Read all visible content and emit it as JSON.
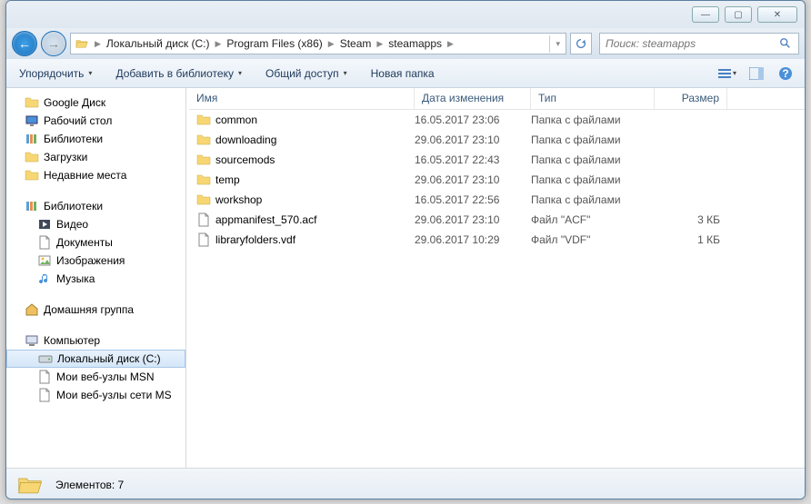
{
  "window_controls": {
    "min": "—",
    "max": "▢",
    "close": "✕"
  },
  "breadcrumbs": [
    "Локальный диск (C:)",
    "Program Files (x86)",
    "Steam",
    "steamapps"
  ],
  "search": {
    "placeholder": "Поиск: steamapps"
  },
  "toolbar": {
    "organize": "Упорядочить",
    "add_library": "Добавить в библиотеку",
    "share": "Общий доступ",
    "new_folder": "Новая папка"
  },
  "columns": {
    "name": "Имя",
    "date": "Дата изменения",
    "type": "Тип",
    "size": "Размер"
  },
  "nav": {
    "favorites": [
      {
        "label": "Google Диск",
        "icon": "gdrive"
      },
      {
        "label": "Рабочий стол",
        "icon": "desktop"
      },
      {
        "label": "Библиотеки",
        "icon": "library"
      },
      {
        "label": "Загрузки",
        "icon": "downloads"
      },
      {
        "label": "Недавние места",
        "icon": "recent"
      }
    ],
    "libraries_header": "Библиотеки",
    "libraries": [
      {
        "label": "Видео",
        "icon": "video"
      },
      {
        "label": "Документы",
        "icon": "doc"
      },
      {
        "label": "Изображения",
        "icon": "image"
      },
      {
        "label": "Музыка",
        "icon": "music"
      }
    ],
    "homegroup": "Домашняя группа",
    "computer": "Компьютер",
    "computer_items": [
      {
        "label": "Локальный диск (C:)",
        "icon": "drive",
        "sel": true
      },
      {
        "label": "Мои веб-узлы MSN",
        "icon": "page"
      },
      {
        "label": "Мои веб-узлы сети MS",
        "icon": "page"
      }
    ]
  },
  "files": [
    {
      "name": "common",
      "date": "16.05.2017 23:06",
      "type": "Папка с файлами",
      "size": "",
      "kind": "folder"
    },
    {
      "name": "downloading",
      "date": "29.06.2017 23:10",
      "type": "Папка с файлами",
      "size": "",
      "kind": "folder"
    },
    {
      "name": "sourcemods",
      "date": "16.05.2017 22:43",
      "type": "Папка с файлами",
      "size": "",
      "kind": "folder"
    },
    {
      "name": "temp",
      "date": "29.06.2017 23:10",
      "type": "Папка с файлами",
      "size": "",
      "kind": "folder"
    },
    {
      "name": "workshop",
      "date": "16.05.2017 22:56",
      "type": "Папка с файлами",
      "size": "",
      "kind": "folder"
    },
    {
      "name": "appmanifest_570.acf",
      "date": "29.06.2017 23:10",
      "type": "Файл \"ACF\"",
      "size": "3 КБ",
      "kind": "file"
    },
    {
      "name": "libraryfolders.vdf",
      "date": "29.06.2017 10:29",
      "type": "Файл \"VDF\"",
      "size": "1 КБ",
      "kind": "file"
    }
  ],
  "status": {
    "count_label": "Элементов: 7"
  }
}
